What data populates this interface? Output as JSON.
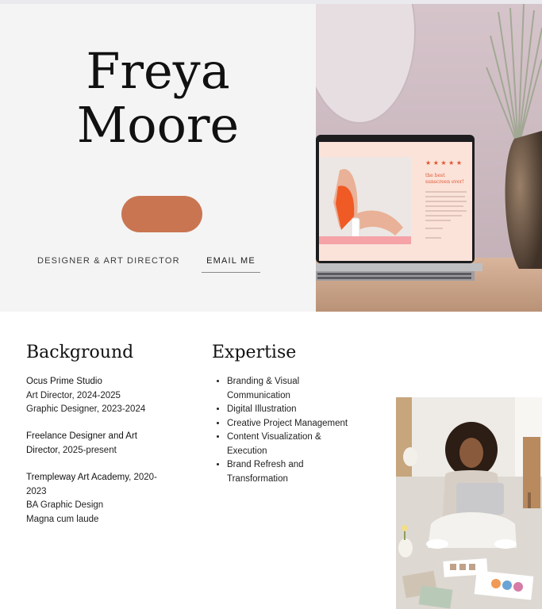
{
  "hero": {
    "first_name": "Freya",
    "last_name": "Moore",
    "role": "DESIGNER & ART DIRECTOR",
    "email_label": "EMAIL ME"
  },
  "laptop_screen": {
    "stars": "★ ★ ★ ★ ★",
    "headline_1": "the best",
    "headline_2": "sunscreen ever!"
  },
  "background": {
    "title": "Background",
    "entries": [
      {
        "org": "Ocus Prime Studio",
        "org_suffix": "",
        "lines": [
          "Art Director, 2024-2025",
          "Graphic Designer, 2023-2024"
        ]
      },
      {
        "org": "Freelance Designer and Art Director",
        "org_suffix": ", 2025-present",
        "lines": []
      },
      {
        "org": "Trempleway Art Academy",
        "org_suffix": ", 2020-2023",
        "lines": [
          "BA Graphic Design",
          "Magna cum laude"
        ]
      }
    ]
  },
  "expertise": {
    "title": "Expertise",
    "items": [
      "Branding & Visual Communication",
      "Digital Illustration",
      "Creative Project Management",
      "Content Visualization & Execution",
      "Brand Refresh and Transformation"
    ]
  },
  "colors": {
    "accent": "#c97552",
    "hero_bg": "#f4f4f4"
  }
}
